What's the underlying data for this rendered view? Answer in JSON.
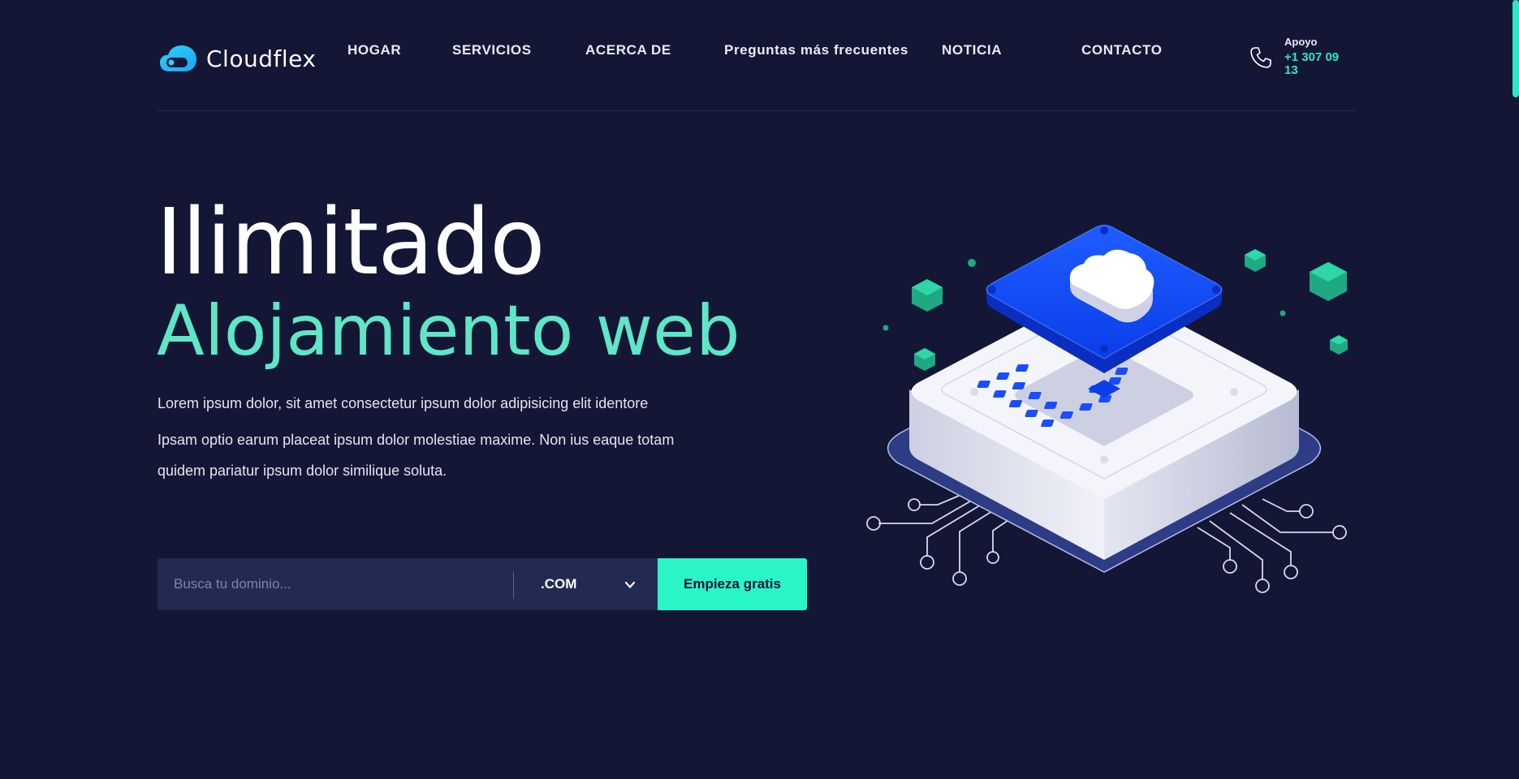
{
  "brand": {
    "name": "Cloudflex",
    "accent": "#2ee6c3",
    "background": "#131735"
  },
  "nav": {
    "items": [
      {
        "label": "HOGAR"
      },
      {
        "label": "SERVICIOS"
      },
      {
        "label": "ACERCA DE"
      },
      {
        "label": "Preguntas más frecuentes"
      },
      {
        "label": "NOTICIA"
      },
      {
        "label": "CONTACTO"
      }
    ]
  },
  "support": {
    "label": "Apoyo",
    "phone": "+1 307 09 13",
    "icon": "phone-icon"
  },
  "hero": {
    "title_line_1": "Ilimitado",
    "title_line_2": "Alojamiento web",
    "description_1": "Lorem ipsum dolor, sit amet consectetur ipsum dolor adipisicing elit identore",
    "description_2": "Ipsam optio earum placeat ipsum dolor molestiae maxime. Non ius eaque totam quidem pariatur ipsum dolor similique soluta."
  },
  "domain_search": {
    "placeholder": "Busca tu dominio...",
    "value": "",
    "tld_selected": ".COM",
    "button_label": "Empieza gratis"
  },
  "illustration": {
    "subject": "cloud-server-chip-illustration",
    "colors": {
      "chip_blue": "#1a4dff",
      "base_white": "#eef0f7",
      "plate_navy": "#2e3b85",
      "cube_green": "#22c39a"
    }
  }
}
